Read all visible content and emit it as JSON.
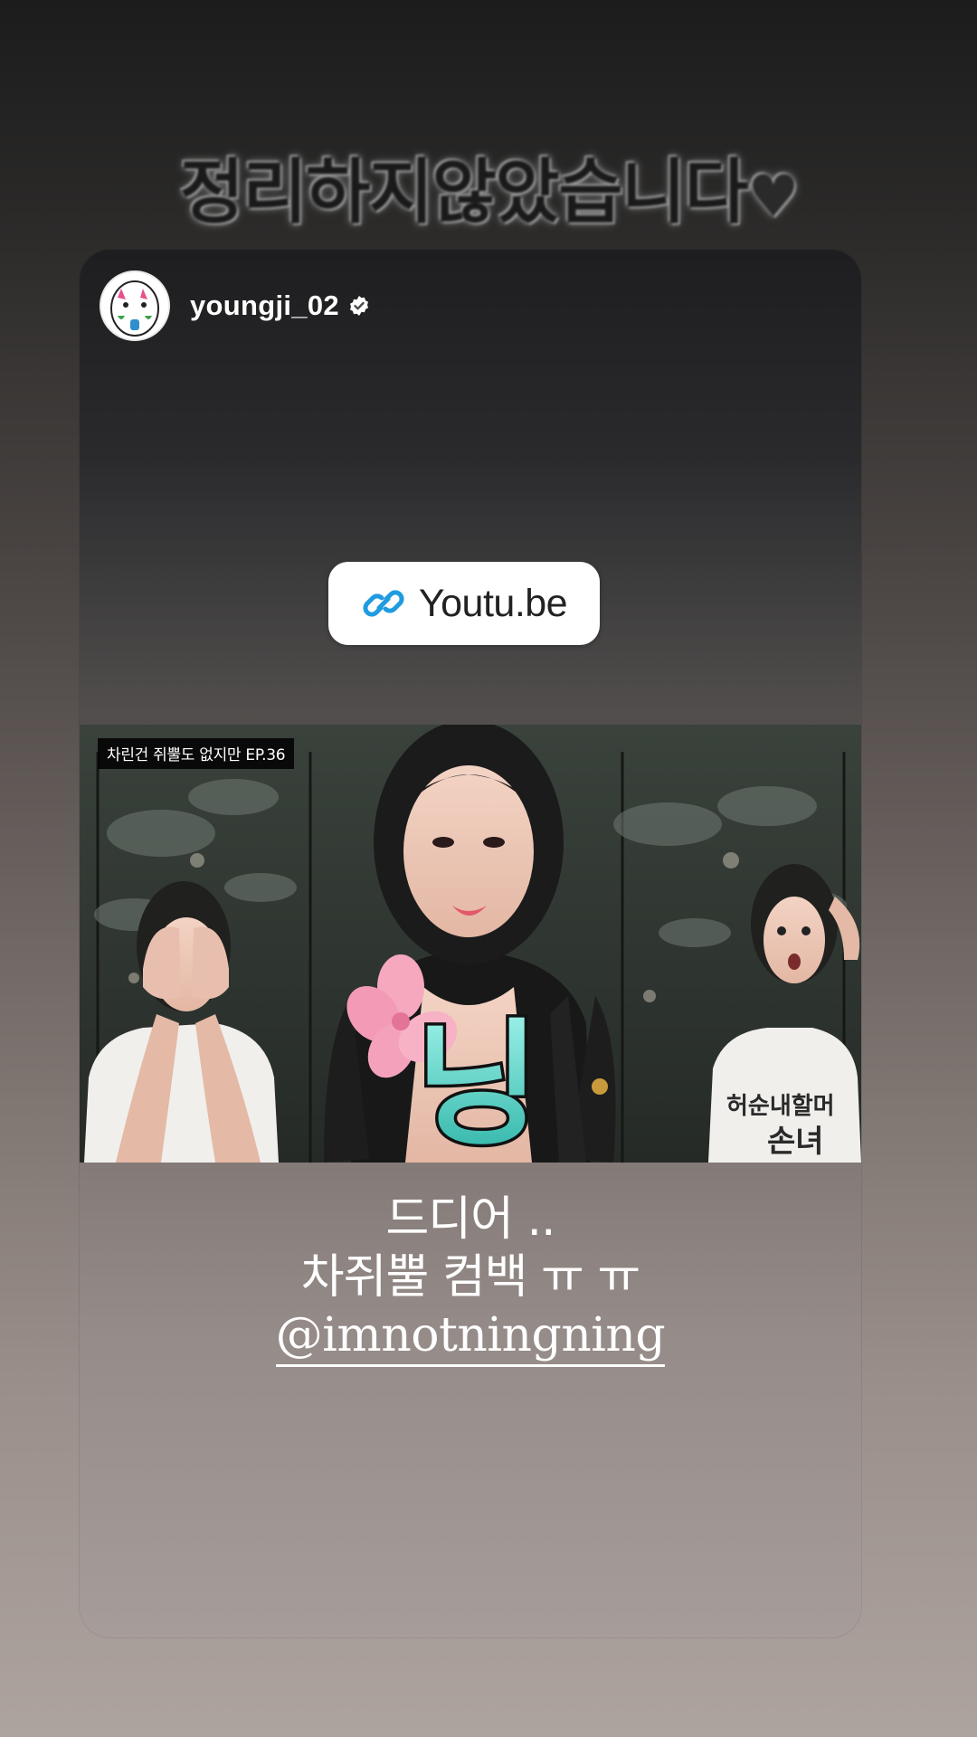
{
  "story": {
    "top_text": "정리하지않았습니다",
    "top_text_heart": "♥"
  },
  "post": {
    "username": "youngji_02",
    "verified_icon": "verified-badge-icon",
    "link_sticker": {
      "icon": "link-icon",
      "label": "Youtu.be"
    },
    "video": {
      "title_label": "차린건 쥐뿔도 없지만 EP.36",
      "overlay_text": "닝"
    },
    "caption": {
      "line1": "드디어 ..",
      "line2": "차쥐뿔 컴백 ㅠ ㅠ",
      "mention": "@imnotningning"
    }
  },
  "colors": {
    "link_icon": "#1f9be0",
    "card_top": "#1e1e20",
    "card_bottom": "#a69c99"
  }
}
